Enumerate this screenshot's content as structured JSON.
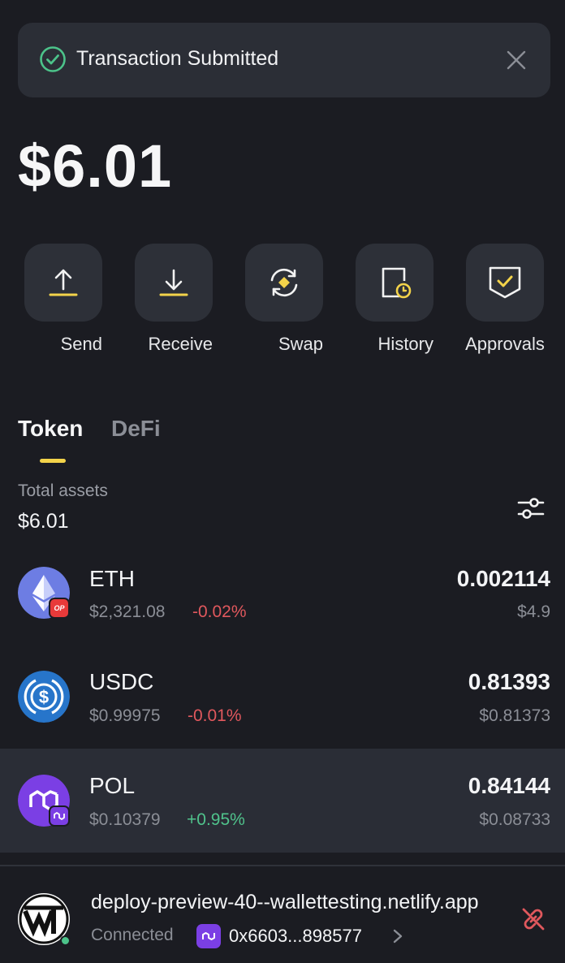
{
  "toast": {
    "title": "Transaction Submitted",
    "accent": "#4cc38a"
  },
  "balance": "$6.01",
  "actions": [
    {
      "label": "Send",
      "icon": "upload-icon"
    },
    {
      "label": "Receive",
      "icon": "download-icon"
    },
    {
      "label": "Swap",
      "icon": "swap-icon"
    },
    {
      "label": "History",
      "icon": "history-icon"
    },
    {
      "label": "Approvals",
      "icon": "shield-check-icon"
    }
  ],
  "tabs": {
    "token": "Token",
    "defi": "DeFi",
    "active": "Token"
  },
  "totals": {
    "label": "Total assets",
    "value": "$6.01"
  },
  "tokens": [
    {
      "symbol": "ETH",
      "price": "$2,321.08",
      "change": "-0.02%",
      "amount": "0.002114",
      "value": "$4.9",
      "network_badge": "OP",
      "direction": "negative"
    },
    {
      "symbol": "USDC",
      "price": "$0.99975",
      "change": "-0.01%",
      "amount": "0.81393",
      "value": "$0.81373",
      "direction": "negative"
    },
    {
      "symbol": "POL",
      "price": "$0.10379",
      "change": "+0.95%",
      "amount": "0.84144",
      "value": "$0.08733",
      "direction": "positive"
    }
  ],
  "connection": {
    "url": "deploy-preview-40--wallettesting.netlify.app",
    "status": "Connected",
    "address": "0x6603...898577"
  },
  "colors": {
    "background": "#1b1c22",
    "accent_yellow": "#f3d34a",
    "negative": "#e0585d",
    "positive": "#50c38c",
    "pol_purple": "#7b3fe4"
  }
}
